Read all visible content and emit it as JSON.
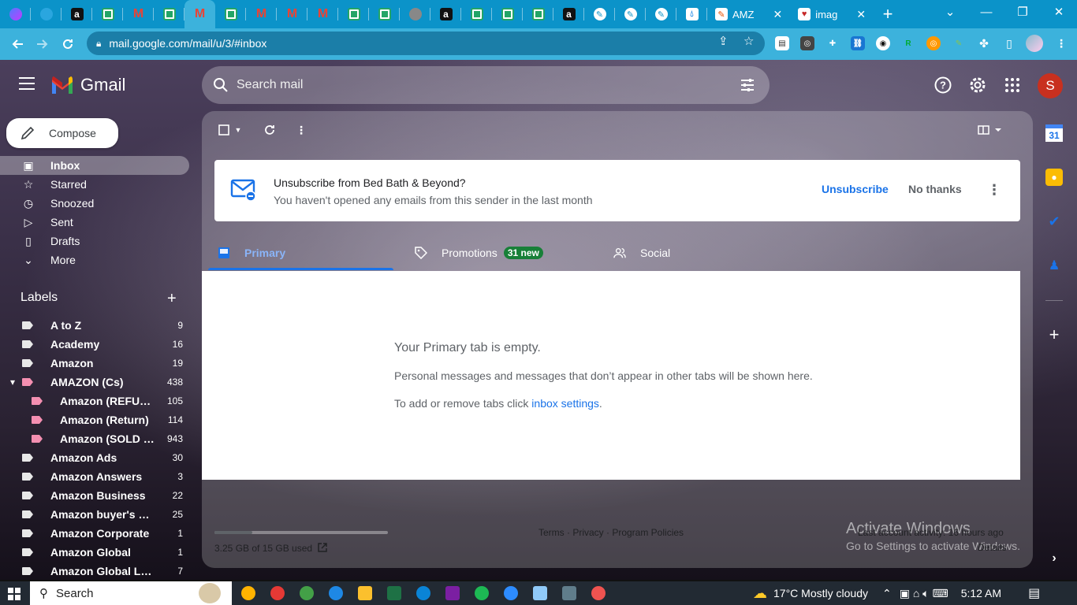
{
  "browser": {
    "tabs": [
      {
        "icon": "messenger-icon"
      },
      {
        "icon": "telegram-icon"
      },
      {
        "icon": "amazon-icon",
        "glyph": "a"
      },
      {
        "icon": "sheets-icon"
      },
      {
        "icon": "gmail-icon",
        "glyph": "M"
      },
      {
        "icon": "sheets-icon"
      },
      {
        "icon": "gmail-icon",
        "glyph": "M",
        "active": true
      },
      {
        "icon": "sheets-icon"
      },
      {
        "icon": "gmail-icon",
        "glyph": "M"
      },
      {
        "icon": "gmail-icon",
        "glyph": "M"
      },
      {
        "icon": "gmail-icon",
        "glyph": "M"
      },
      {
        "icon": "sheets-icon"
      },
      {
        "icon": "sheets-icon"
      },
      {
        "icon": "globe-icon"
      },
      {
        "icon": "amazon-icon",
        "glyph": "a"
      },
      {
        "icon": "sheets-icon"
      },
      {
        "icon": "sheets-icon"
      },
      {
        "icon": "sheets-icon"
      },
      {
        "icon": "amazon-icon",
        "glyph": "a"
      },
      {
        "icon": "feather-icon"
      },
      {
        "icon": "feather-icon"
      },
      {
        "icon": "feather-icon"
      },
      {
        "icon": "drop-icon"
      }
    ],
    "titled_tabs": [
      {
        "title": "AMZ",
        "close": "✕"
      },
      {
        "title": "imag",
        "close": "✕"
      }
    ],
    "new_tab": "+",
    "url": "mail.google.com/mail/u/3/#inbox",
    "window_controls": {
      "minimize": "—",
      "restore": "❐",
      "close": "✕"
    }
  },
  "gmail": {
    "brand": "Gmail",
    "search_placeholder": "Search mail",
    "avatar_letter": "S",
    "compose": "Compose",
    "nav": [
      {
        "label": "Inbox",
        "icon": "inbox-icon",
        "active": true
      },
      {
        "label": "Starred",
        "icon": "star-icon"
      },
      {
        "label": "Snoozed",
        "icon": "clock-icon"
      },
      {
        "label": "Sent",
        "icon": "send-icon"
      },
      {
        "label": "Drafts",
        "icon": "draft-icon"
      },
      {
        "label": "More",
        "icon": "chevron-down-icon"
      }
    ],
    "labels_header": "Labels",
    "labels": [
      {
        "name": "A to Z",
        "count": "9",
        "color": "#e8e8e8",
        "indent": false
      },
      {
        "name": "Academy",
        "count": "16",
        "color": "#e8e8e8",
        "indent": false
      },
      {
        "name": "Amazon",
        "count": "19",
        "color": "#e8e8e8",
        "indent": false
      },
      {
        "name": "AMAZON (Cs)",
        "count": "438",
        "color": "#f48fb1",
        "indent": false,
        "expanded": true
      },
      {
        "name": "Amazon (REFU…",
        "count": "105",
        "color": "#f48fb1",
        "indent": true
      },
      {
        "name": "Amazon (Return)",
        "count": "114",
        "color": "#f48fb1",
        "indent": true
      },
      {
        "name": "Amazon (SOLD …",
        "count": "943",
        "color": "#f48fb1",
        "indent": true
      },
      {
        "name": "Amazon Ads",
        "count": "30",
        "color": "#e8e8e8",
        "indent": false
      },
      {
        "name": "Amazon Answers",
        "count": "3",
        "color": "#e8e8e8",
        "indent": false
      },
      {
        "name": "Amazon Business",
        "count": "22",
        "color": "#e8e8e8",
        "indent": false
      },
      {
        "name": "Amazon buyer's m…",
        "count": "25",
        "color": "#e8e8e8",
        "indent": false
      },
      {
        "name": "Amazon Corporate",
        "count": "1",
        "color": "#e8e8e8",
        "indent": false
      },
      {
        "name": "Amazon Global",
        "count": "1",
        "color": "#e8e8e8",
        "indent": false
      },
      {
        "name": "Amazon Global Logi…",
        "count": "7",
        "color": "#e8e8e8",
        "indent": false
      }
    ],
    "unsubscribe": {
      "title": "Unsubscribe from Bed Bath & Beyond?",
      "subtitle": "You haven't opened any emails from this sender in the last month",
      "primary_action": "Unsubscribe",
      "secondary_action": "No thanks"
    },
    "tabs": [
      {
        "label": "Primary",
        "icon": "inbox-tab-icon",
        "active": true
      },
      {
        "label": "Promotions",
        "icon": "tag-icon",
        "badge": "31 new"
      },
      {
        "label": "Social",
        "icon": "people-icon"
      }
    ],
    "empty": {
      "title": "Your Primary tab is empty.",
      "description": "Personal messages and messages that don’t appear in other tabs will be shown here.",
      "hint_prefix": "To add or remove tabs click ",
      "hint_link": "inbox settings",
      "hint_suffix": "."
    },
    "footer": {
      "storage": "3.25 GB of 15 GB used",
      "storage_used_fraction": 0.2167,
      "links": "Terms · Privacy · Program Policies",
      "last_activity": "Last account activity: 16 hours ago",
      "details": "Details"
    },
    "watermark": {
      "line1": "Activate Windows",
      "line2": "Go to Settings to activate Windows."
    }
  },
  "taskbar": {
    "search": "Search",
    "weather": "17°C  Mostly cloudy",
    "time": "5:12 AM"
  }
}
